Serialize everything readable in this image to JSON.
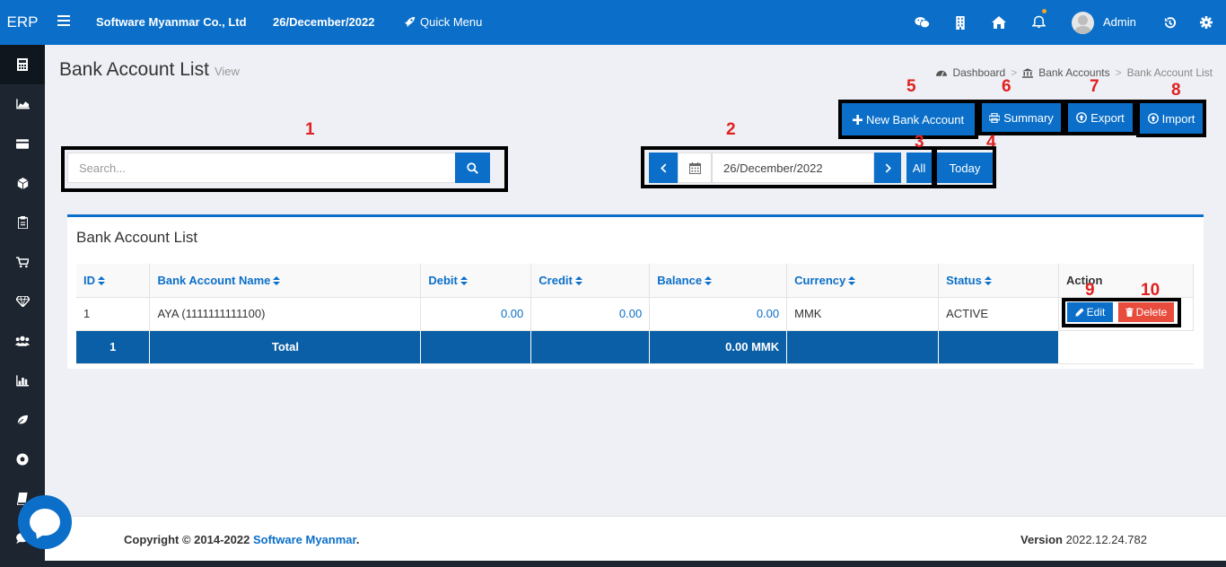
{
  "app": {
    "brand": "ERP",
    "company": "Software Myanmar Co., Ltd",
    "date": "26/December/2022",
    "quick_menu": "Quick Menu",
    "user": "Admin"
  },
  "topbar_icons": [
    "wechat-icon",
    "building-icon",
    "home-icon",
    "bell-icon",
    "history-icon",
    "gear-icon"
  ],
  "sidebar": {
    "items": [
      "calculator-icon",
      "area-chart-icon",
      "credit-card-icon",
      "cube-icon",
      "clipboard-icon",
      "cart-icon",
      "diamond-icon",
      "users-icon",
      "bar-chart-icon",
      "leaf-icon",
      "soccer-icon",
      "book-icon",
      "comment-icon"
    ]
  },
  "page": {
    "title": "Bank Account List",
    "subtitle": "View"
  },
  "breadcrumb": {
    "items": [
      "Dashboard",
      "Bank Accounts",
      "Bank Account List"
    ],
    "separator": ">"
  },
  "toolbar": {
    "new_label": "New Bank Account",
    "summary_label": "Summary",
    "export_label": "Export",
    "import_label": "Import",
    "all_label": "All",
    "today_label": "Today",
    "search_placeholder": "Search...",
    "date_value": "26/December/2022"
  },
  "annotations": [
    "1",
    "2",
    "3",
    "4",
    "5",
    "6",
    "7",
    "8",
    "9",
    "10"
  ],
  "card": {
    "title": "Bank Account List"
  },
  "table": {
    "headers": [
      "ID",
      "Bank Account Name",
      "Debit",
      "Credit",
      "Balance",
      "Currency",
      "Status",
      "Action"
    ],
    "rows": [
      {
        "id": "1",
        "name": "AYA (1111111111100)",
        "debit": "0.00",
        "credit": "0.00",
        "balance": "0.00",
        "currency": "MMK",
        "status": "ACTIVE"
      }
    ],
    "total": {
      "count": "1",
      "label": "Total",
      "balance": "0.00 MMK"
    },
    "edit_label": "Edit",
    "delete_label": "Delete"
  },
  "footer": {
    "copyright_prefix": "Copyright © 2014-2022",
    "company_link": "Software Myanmar",
    "period": ".",
    "version_label": "Version",
    "version_value": "2022.12.24.782"
  },
  "colors": {
    "primary": "#0b6fc9",
    "sidebar": "#1d2530",
    "danger": "#e74c3c",
    "annotation": "#e0201f"
  }
}
